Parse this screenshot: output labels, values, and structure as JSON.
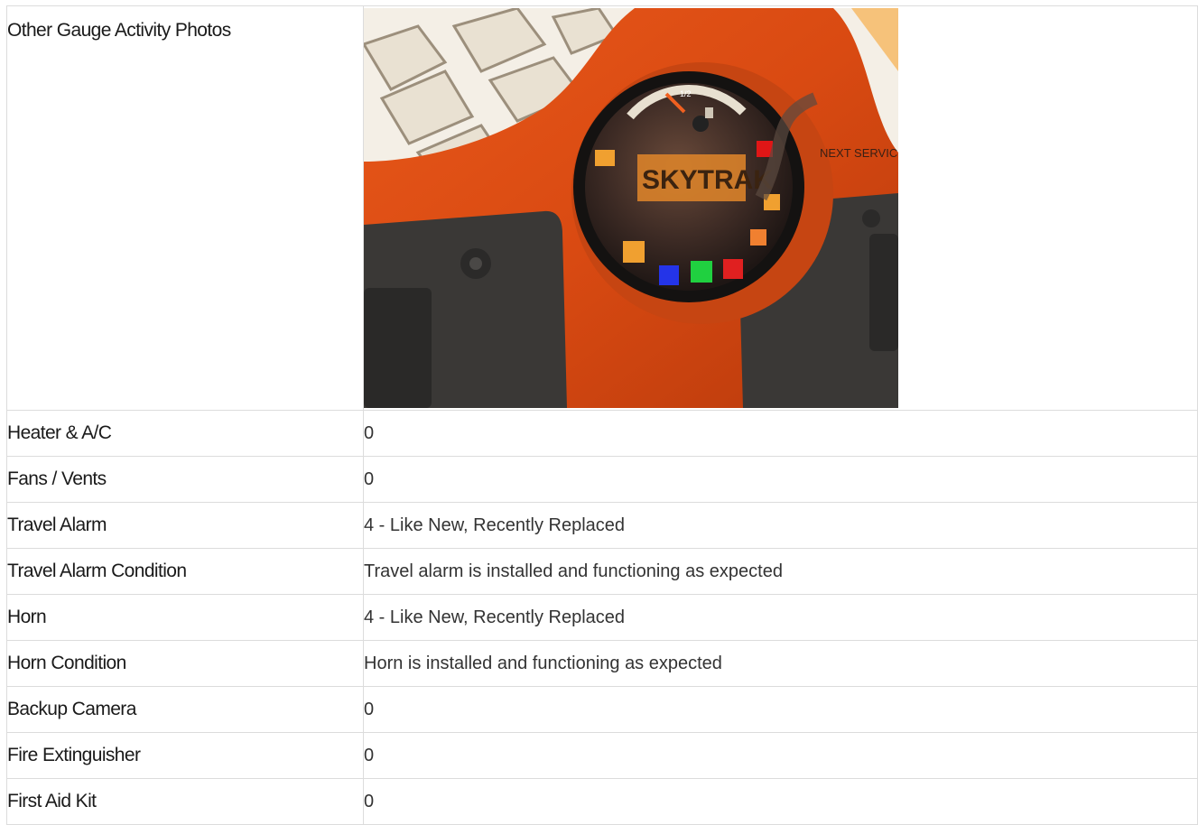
{
  "photo_row": {
    "label": "Other Gauge Activity Photos",
    "photo": {
      "brand_text": "SKYTRAK",
      "sticker_text": "NEXT SERVIC",
      "gauge_mark": "1/2"
    }
  },
  "rows": [
    {
      "label": "Heater & A/C",
      "value": "0"
    },
    {
      "label": "Fans / Vents",
      "value": "0"
    },
    {
      "label": "Travel Alarm",
      "value": "4 - Like New, Recently Replaced"
    },
    {
      "label": "Travel Alarm Condition",
      "value": "Travel alarm is installed and functioning as expected"
    },
    {
      "label": "Horn",
      "value": "4 - Like New, Recently Replaced"
    },
    {
      "label": "Horn Condition",
      "value": "Horn is installed and functioning as expected"
    },
    {
      "label": "Backup Camera",
      "value": "0"
    },
    {
      "label": "Fire Extinguisher",
      "value": "0"
    },
    {
      "label": "First Aid Kit",
      "value": "0"
    }
  ]
}
